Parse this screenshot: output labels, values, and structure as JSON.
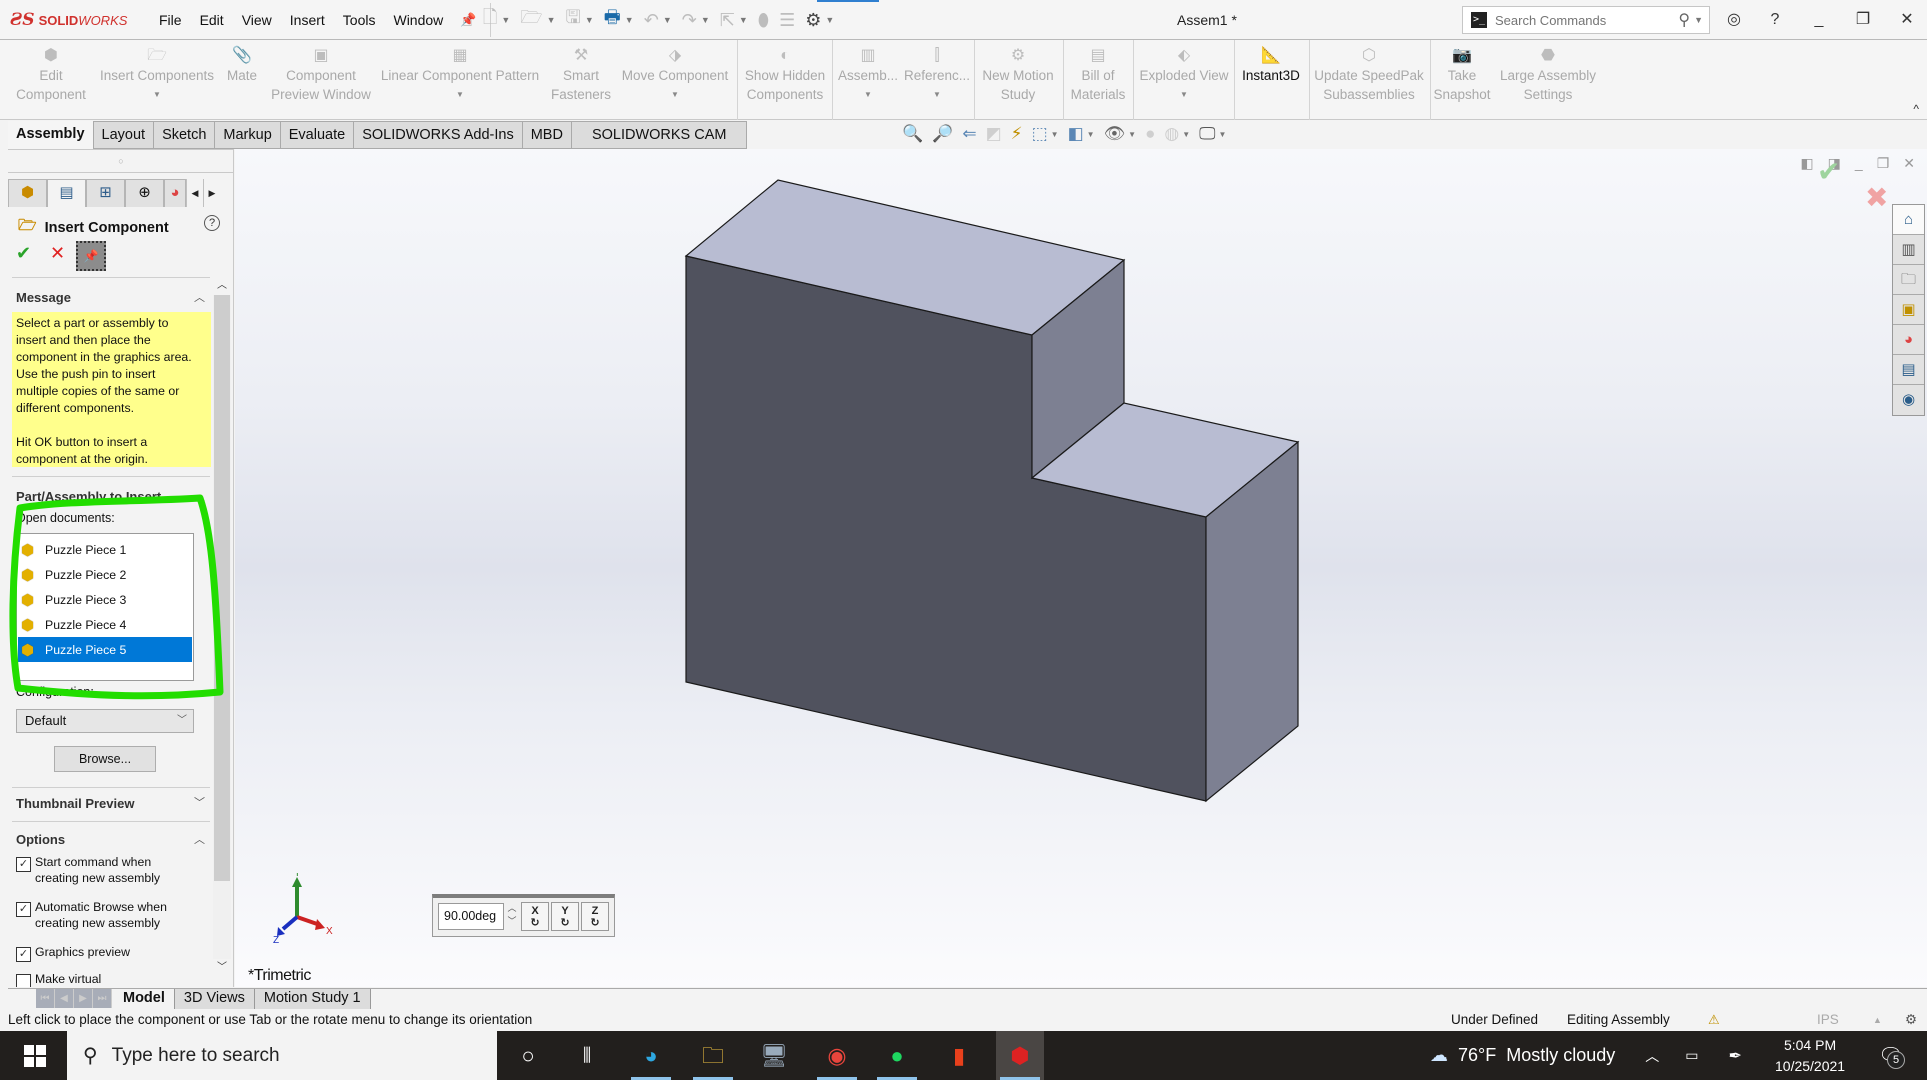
{
  "app": {
    "brand_prefix": "ƧS",
    "brand_bold": "SOLID",
    "brand_light": "WORKS",
    "document_title": "Assem1 *"
  },
  "menu": [
    "File",
    "Edit",
    "View",
    "Insert",
    "Tools",
    "Window"
  ],
  "search": {
    "placeholder": "Search Commands"
  },
  "command_manager": [
    {
      "label": "Edit Component",
      "enabled": false
    },
    {
      "label": "Insert Components",
      "enabled": false,
      "dropdown": true
    },
    {
      "label": "Mate",
      "enabled": false
    },
    {
      "label": "Component Preview Window",
      "enabled": false
    },
    {
      "label": "Linear Component Pattern",
      "enabled": false,
      "dropdown": true
    },
    {
      "label": "Smart Fasteners",
      "enabled": false
    },
    {
      "label": "Move Component",
      "enabled": false,
      "dropdown": true
    },
    {
      "label": "Show Hidden Components",
      "enabled": false
    },
    {
      "label": "Assemb...",
      "enabled": false,
      "dropdown": true
    },
    {
      "label": "Referenc...",
      "enabled": false,
      "dropdown": true
    },
    {
      "label": "New Motion Study",
      "enabled": false
    },
    {
      "label": "Bill of Materials",
      "enabled": false
    },
    {
      "label": "Exploded View",
      "enabled": false,
      "dropdown": true
    },
    {
      "label": "Instant3D",
      "enabled": true
    },
    {
      "label": "Update SpeedPak Subassemblies",
      "enabled": false
    },
    {
      "label": "Take Snapshot",
      "enabled": false
    },
    {
      "label": "Large Assembly Settings",
      "enabled": false
    }
  ],
  "cmd_labels": {
    "edit_component_1": "Edit",
    "edit_component_2": "Component",
    "insert_components": "Insert Components",
    "mate": "Mate",
    "preview_1": "Component",
    "preview_2": "Preview Window",
    "linear_pattern": "Linear Component Pattern",
    "smart_1": "Smart",
    "smart_2": "Fasteners",
    "move_component": "Move Component",
    "show_hidden_1": "Show Hidden",
    "show_hidden_2": "Components",
    "assemb": "Assemb...",
    "referenc": "Referenc...",
    "motion_1": "New Motion",
    "motion_2": "Study",
    "bom_1": "Bill of",
    "bom_2": "Materials",
    "exploded": "Exploded View",
    "instant3d": "Instant3D",
    "speedpak_1": "Update SpeedPak",
    "speedpak_2": "Subassemblies",
    "snapshot_1": "Take",
    "snapshot_2": "Snapshot",
    "large_1": "Large Assembly",
    "large_2": "Settings"
  },
  "command_tabs": [
    "Assembly",
    "Layout",
    "Sketch",
    "Markup",
    "Evaluate",
    "SOLIDWORKS Add-Ins",
    "MBD",
    "SOLIDWORKS CAM"
  ],
  "active_command_tab": "Assembly",
  "property_manager": {
    "title": "Insert Component",
    "message_header": "Message",
    "message_text": "Select a part or assembly to\ninsert and then place the\ncomponent in the graphics area.\nUse the push pin to insert\nmultiple copies of the same or\ndifferent components.\n\nHit OK button to insert a\ncomponent at the origin.",
    "part_group_header": "Part/Assembly to Insert",
    "open_documents_label": "Open documents:",
    "open_documents": [
      "Puzzle Piece 1",
      "Puzzle Piece 2",
      "Puzzle Piece 3",
      "Puzzle Piece 4",
      "Puzzle Piece 5"
    ],
    "selected_document": "Puzzle Piece 5",
    "configuration_label": "Configuration:",
    "configuration_value": "Default",
    "browse_label": "Browse...",
    "thumbnail_header": "Thumbnail Preview",
    "options_header": "Options",
    "options": [
      {
        "label_1": "Start command when",
        "label_2": "creating new assembly",
        "checked": true
      },
      {
        "label_1": "Automatic Browse when",
        "label_2": "creating new assembly",
        "checked": true
      },
      {
        "label_1": "Graphics preview",
        "label_2": "",
        "checked": true
      },
      {
        "label_1": "Make virtual",
        "label_2": "",
        "checked": false
      }
    ]
  },
  "graphics": {
    "view_orientation": "*Trimetric",
    "rotate_value": "90.00deg",
    "rotate_axes": [
      "X",
      "Y",
      "Z"
    ],
    "triad_labels": {
      "x": "X",
      "y": "Y",
      "z": "Z"
    },
    "annotation_color": "#22dd00",
    "model_colors": {
      "front": "#50525e",
      "top": "#b8bcd2",
      "side": "#7d8092",
      "edge": "#1a1a1a"
    }
  },
  "bottom_tabs": [
    "Model",
    "3D Views",
    "Motion Study 1"
  ],
  "active_bottom_tab": "Model",
  "status": {
    "message": "Left click to place the component or use Tab or the rotate menu to change its orientation",
    "definition": "Under Defined",
    "mode": "Editing Assembly",
    "units": "IPS"
  },
  "taskbar": {
    "search_placeholder": "Type here to search",
    "weather": "76°F  Mostly cloudy",
    "time": "5:04 PM",
    "date": "10/25/2021",
    "notification_count": "5",
    "apps": [
      "Cortana",
      "Task View",
      "Microsoft Edge",
      "File Explorer",
      "Remote Desktop",
      "Google Chrome",
      "Spotify",
      "Microsoft Office",
      "SOLIDWORKS 2021"
    ]
  }
}
